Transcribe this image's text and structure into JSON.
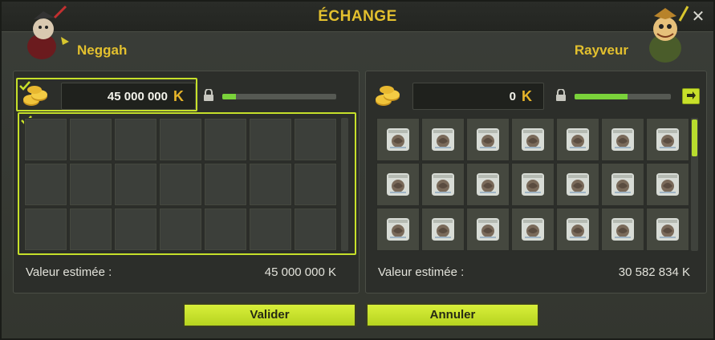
{
  "window": {
    "title": "ÉCHANGE"
  },
  "left_player": {
    "name": "Neggah",
    "kamas": "45 000 000",
    "estimated_label": "Valeur estimée :",
    "estimated_value": "45 000 000 K",
    "ready_progress": 0.12,
    "grid": {
      "rows": 3,
      "cols": 7,
      "filled": 0
    }
  },
  "right_player": {
    "name": "Rayveur",
    "kamas": "0",
    "estimated_label": "Valeur estimée :",
    "estimated_value": "30 582 834 K",
    "ready_progress": 0.55,
    "grid": {
      "rows": 3,
      "cols": 7,
      "filled": 21,
      "item_icon": "scroll-parchment-icon"
    }
  },
  "currency_symbol": "K",
  "buttons": {
    "validate": "Valider",
    "cancel": "Annuler"
  },
  "colors": {
    "accent": "#c8e02a",
    "gold": "#e3c02e",
    "bar_fill": "#7ad23a"
  }
}
